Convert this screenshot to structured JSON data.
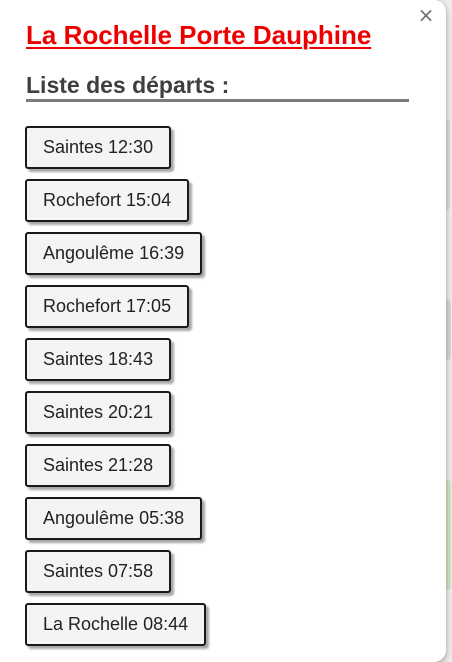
{
  "popup": {
    "close_label": "×",
    "station_name": "La Rochelle Porte Dauphine",
    "list_heading": "Liste des départs :"
  },
  "departures": [
    {
      "destination": "Saintes",
      "time": "12:30",
      "label": "Saintes 12:30"
    },
    {
      "destination": "Rochefort",
      "time": "15:04",
      "label": "Rochefort 15:04"
    },
    {
      "destination": "Angoulême",
      "time": "16:39",
      "label": "Angoulême 16:39"
    },
    {
      "destination": "Rochefort",
      "time": "17:05",
      "label": "Rochefort 17:05"
    },
    {
      "destination": "Saintes",
      "time": "18:43",
      "label": "Saintes 18:43"
    },
    {
      "destination": "Saintes",
      "time": "20:21",
      "label": "Saintes 20:21"
    },
    {
      "destination": "Saintes",
      "time": "21:28",
      "label": "Saintes 21:28"
    },
    {
      "destination": "Angoulême",
      "time": "05:38",
      "label": "Angoulême 05:38"
    },
    {
      "destination": "Saintes",
      "time": "07:58",
      "label": "Saintes 07:58"
    },
    {
      "destination": "La Rochelle",
      "time": "08:44",
      "label": "La Rochelle 08:44"
    }
  ],
  "colors": {
    "title": "#ee0000",
    "heading": "#3f3f3f",
    "heading_rule": "#7c7c7c",
    "button_bg": "#f4f4f4",
    "button_border": "#1a1a1a"
  }
}
